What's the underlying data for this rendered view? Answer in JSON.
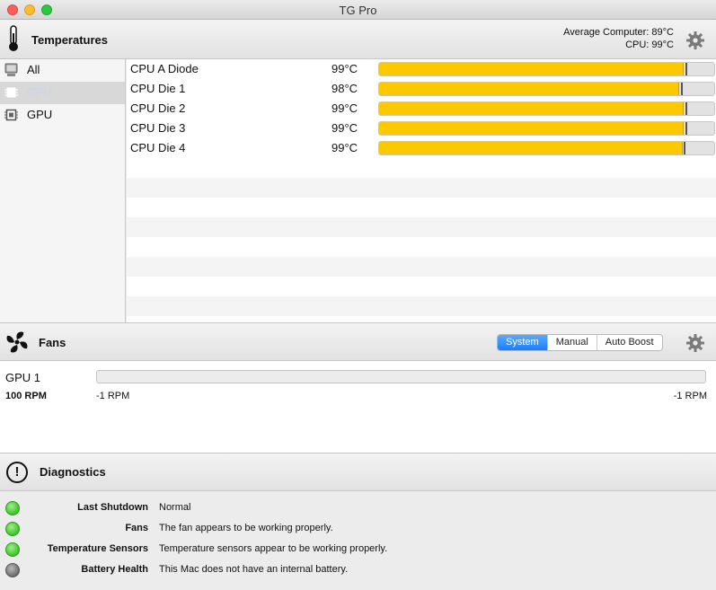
{
  "window": {
    "title": "TG Pro"
  },
  "temperatures": {
    "title": "Temperatures",
    "average_line": "Average Computer:  89°C",
    "cpu_line": "CPU:  99°C"
  },
  "sidebar": {
    "items": [
      {
        "label": "All",
        "icon": "computer-icon",
        "selected": false
      },
      {
        "label": "CPU",
        "icon": "cpu-chip-icon",
        "selected": true
      },
      {
        "label": "GPU",
        "icon": "gpu-chip-icon",
        "selected": false
      }
    ]
  },
  "sensors": [
    {
      "name": "CPU A Diode",
      "temp": "99°C",
      "level_pct": 91,
      "marker_pct": 91.5
    },
    {
      "name": "CPU Die 1",
      "temp": "98°C",
      "level_pct": 89.5,
      "marker_pct": 90
    },
    {
      "name": "CPU Die 2",
      "temp": "99°C",
      "level_pct": 91,
      "marker_pct": 91.5
    },
    {
      "name": "CPU Die 3",
      "temp": "99°C",
      "level_pct": 91,
      "marker_pct": 91.5
    },
    {
      "name": "CPU Die 4",
      "temp": "99°C",
      "level_pct": 90.5,
      "marker_pct": 91
    }
  ],
  "fans": {
    "title": "Fans",
    "modes": [
      "System",
      "Manual",
      "Auto Boost"
    ],
    "active_mode": "System",
    "items": [
      {
        "name": "GPU 1",
        "min": "100 RPM",
        "current": "-1 RPM",
        "max": "-1 RPM"
      }
    ]
  },
  "diagnostics": {
    "title": "Diagnostics",
    "rows": [
      {
        "label": "Last Shutdown",
        "value": "Normal",
        "status": "green"
      },
      {
        "label": "Fans",
        "value": "The fan appears to be working properly.",
        "status": "green"
      },
      {
        "label": "Temperature Sensors",
        "value": "Temperature sensors appear to be working properly.",
        "status": "green"
      },
      {
        "label": "Battery Health",
        "value": "This Mac does not have an internal battery.",
        "status": "gray"
      }
    ]
  },
  "colors": {
    "bar_fill": "#fcc900",
    "segment_active": "#1a7ef9",
    "status_green": "#3ec32a",
    "status_gray": "#6e6e6e"
  }
}
